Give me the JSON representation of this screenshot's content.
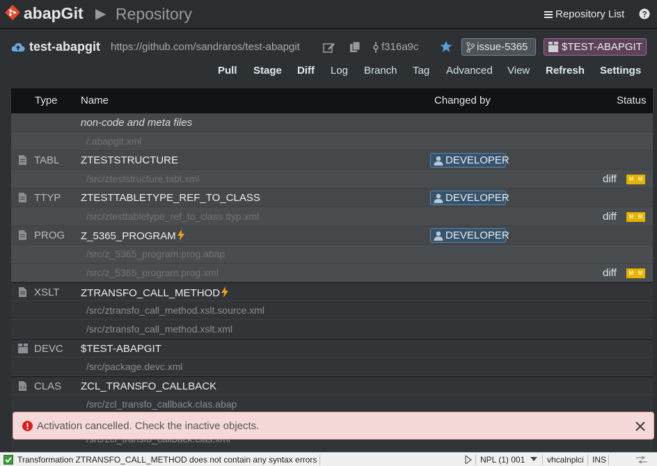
{
  "header": {
    "brand": "abapGit",
    "breadcrumb_separator": "▶",
    "page_title": "Repository",
    "repo_list_label": "Repository List",
    "help_icon": "help-circle-icon"
  },
  "repo": {
    "name": "test-abapgit",
    "url": "https://github.com/sandraros/test-abapgit",
    "commit": "f316a9c",
    "branch": "issue-5365",
    "package": "$TEST-ABAPGIT"
  },
  "toolbar": {
    "items": [
      "Pull",
      "Stage",
      "Diff",
      "Log",
      "Branch",
      "Tag",
      "Advanced",
      "View",
      "Refresh",
      "Settings"
    ]
  },
  "table": {
    "headers": {
      "type": "Type",
      "name": "Name",
      "changed_by": "Changed by",
      "status": "Status"
    },
    "rows": [
      {
        "kind": "meta",
        "name": "non-code and meta files"
      },
      {
        "kind": "path",
        "path": "/.abapgit.xml"
      },
      {
        "kind": "object",
        "type": "TABL",
        "name": "ZTESTSTRUCTURE",
        "changed_by": "DEVELOPER"
      },
      {
        "kind": "path",
        "path": "/src/zteststructure.tabl.xml",
        "diff": "diff",
        "status": "M M"
      },
      {
        "kind": "object",
        "type": "TTYP",
        "name": "ZTESTTABLETYPE_REF_TO_CLASS",
        "changed_by": "DEVELOPER"
      },
      {
        "kind": "path",
        "path": "/src/ztesttabletype_ref_to_class.ttyp.xml",
        "diff": "diff",
        "status": "M M"
      },
      {
        "kind": "object",
        "type": "PROG",
        "name": "Z_5365_PROGRAM",
        "changed_by": "DEVELOPER",
        "inactive": true
      },
      {
        "kind": "path",
        "path": "/src/z_5365_program.prog.abap"
      },
      {
        "kind": "path",
        "path": "/src/z_5365_program.prog.xml",
        "diff": "diff",
        "status": "M M"
      },
      {
        "kind": "object",
        "type": "XSLT",
        "name": "ZTRANSFO_CALL_METHOD",
        "inactive": true
      },
      {
        "kind": "path",
        "path": "/src/ztransfo_call_method.xslt.source.xml"
      },
      {
        "kind": "path",
        "path": "/src/ztransfo_call_method.xslt.xml"
      },
      {
        "kind": "object",
        "type": "DEVC",
        "name": "$TEST-ABAPGIT"
      },
      {
        "kind": "path",
        "path": "/src/package.devc.xml"
      },
      {
        "kind": "object",
        "type": "CLAS",
        "name": "ZCL_TRANSFO_CALLBACK"
      },
      {
        "kind": "path",
        "path": "/src/zcl_transfo_callback.clas.abap"
      },
      {
        "kind": "path",
        "path": "/src/zcl_transfo_callback.clas.xml"
      }
    ]
  },
  "toast": {
    "message": "Activation cancelled. Check the inactive objects."
  },
  "statusbar": {
    "message": "Transformation ZTRANSFO_CALL_METHOD does not contain any syntax errors",
    "system": "NPL (1) 001",
    "host": "vhcalnplci",
    "mode": "INS"
  },
  "colors": {
    "accent_logo": "#e8492c",
    "inactive_bolt": "#f0a020",
    "status_badge": "#e6b200"
  }
}
